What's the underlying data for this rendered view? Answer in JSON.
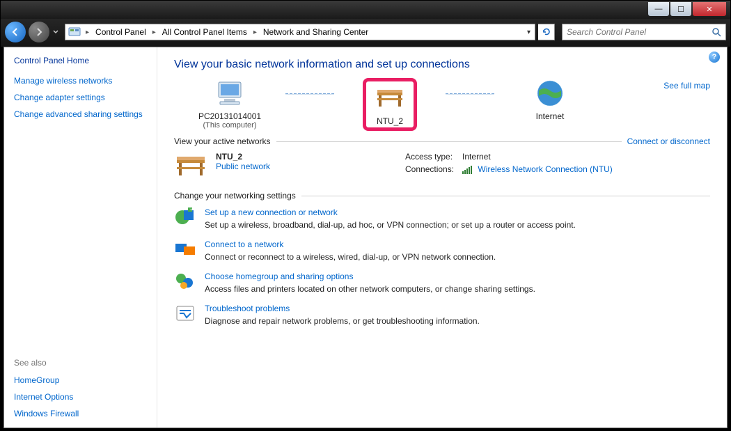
{
  "titlebar": {
    "min": "—",
    "max": "☐",
    "close": "✕"
  },
  "nav": {
    "breadcrumb": [
      "Control Panel",
      "All Control Panel Items",
      "Network and Sharing Center"
    ],
    "search_placeholder": "Search Control Panel"
  },
  "sidebar": {
    "home": "Control Panel Home",
    "links": [
      "Manage wireless networks",
      "Change adapter settings",
      "Change advanced sharing settings"
    ],
    "seealso_label": "See also",
    "seealso": [
      "HomeGroup",
      "Internet Options",
      "Windows Firewall"
    ]
  },
  "main": {
    "title": "View your basic network information and set up connections",
    "map": {
      "pc_name": "PC20131014001",
      "pc_sub": "(This computer)",
      "net_name": "NTU_2",
      "internet": "Internet",
      "fullmap": "See full map"
    },
    "active_label": "View your active networks",
    "connect_link": "Connect or disconnect",
    "active": {
      "name": "NTU_2",
      "type": "Public network",
      "access_label": "Access type:",
      "access_value": "Internet",
      "conn_label": "Connections:",
      "conn_value": "Wireless Network Connection (NTU)"
    },
    "change_label": "Change your networking settings",
    "tasks": [
      {
        "title": "Set up a new connection or network",
        "desc": "Set up a wireless, broadband, dial-up, ad hoc, or VPN connection; or set up a router or access point."
      },
      {
        "title": "Connect to a network",
        "desc": "Connect or reconnect to a wireless, wired, dial-up, or VPN network connection."
      },
      {
        "title": "Choose homegroup and sharing options",
        "desc": "Access files and printers located on other network computers, or change sharing settings."
      },
      {
        "title": "Troubleshoot problems",
        "desc": "Diagnose and repair network problems, or get troubleshooting information."
      }
    ]
  }
}
